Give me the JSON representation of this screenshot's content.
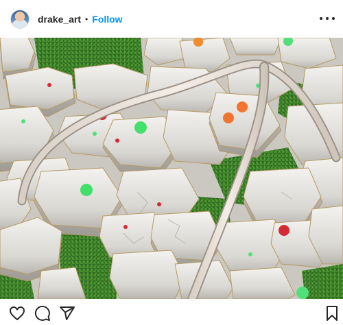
{
  "post": {
    "username": "drake_art",
    "separator": "•",
    "follow_label": "Follow",
    "image_description_icon": "artwork-image"
  },
  "icons": {
    "more": "more-options-icon",
    "like": "heart-icon",
    "comment": "comment-icon",
    "share": "share-icon",
    "save": "bookmark-icon"
  },
  "colors": {
    "follow": "#0095f6",
    "text": "#262626"
  }
}
